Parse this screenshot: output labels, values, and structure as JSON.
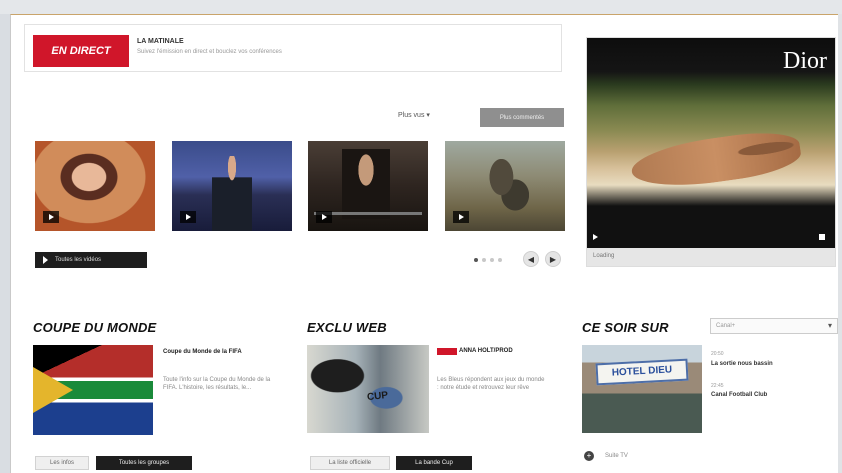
{
  "live": {
    "badge": "EN DIRECT",
    "title": "LA MATINALE",
    "subtitle": "Suivez l'émission en direct et bouclez vos conférences"
  },
  "videos": {
    "sort_label": "Plus vus ▾",
    "sort_button": "Plus commentés",
    "all_videos": "Toutes les vidéos",
    "pager": {
      "pages": 4,
      "active": 1,
      "prev": "◀",
      "next": "▶"
    }
  },
  "ad": {
    "brand": "Dior",
    "caption": "Loading"
  },
  "sections": {
    "coupe": {
      "title": "COUPE DU MONDE",
      "article_title": "Coupe du Monde de la FIFA",
      "article_desc": "Toute l'info sur la Coupe du Monde de la FIFA. L'histoire, les résultats, le...",
      "btn_info": "Les infos",
      "btn_groups": "Toutes les groupes"
    },
    "exclu": {
      "title": "EXCLU WEB",
      "article_title": "ANNA HOLT/PROD",
      "article_desc": "Les Bleus répondent aux jeux du monde : notre étude et retrouvez leur rêve",
      "btn_official": "La liste officielle",
      "btn_cup": "La bande Cup",
      "graffiti_text": "CUP"
    },
    "ce_soir": {
      "title": "CE SOIR SUR",
      "select_value": "Canal+",
      "sign_text": "HOTEL DIEU",
      "items": [
        {
          "time": "20:50",
          "title": "La sortie nous bassin"
        },
        {
          "time": "22:45",
          "title": "Canal Football Club"
        }
      ],
      "more_icon": "+",
      "more_label": "Suite TV"
    }
  }
}
